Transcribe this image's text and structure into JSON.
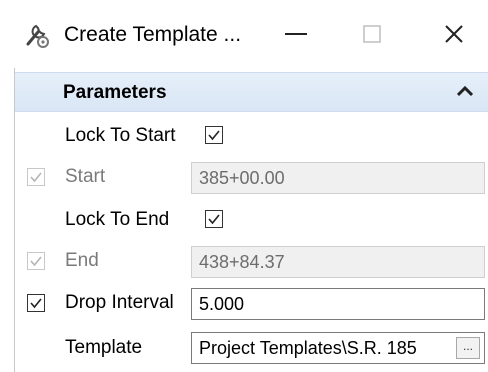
{
  "window": {
    "title": "Create Template ...",
    "min_glyph": "—",
    "max_glyph": "☐",
    "close_glyph": "✕"
  },
  "parameters": {
    "header": "Parameters",
    "lock_to_start": {
      "label": "Lock To Start",
      "checked": true
    },
    "start": {
      "label": "Start",
      "value": "385+00.00",
      "enabled": false,
      "checked": true
    },
    "lock_to_end": {
      "label": "Lock To End",
      "checked": true
    },
    "end": {
      "label": "End",
      "value": "438+84.37",
      "enabled": false,
      "checked": true
    },
    "drop_interval": {
      "label": "Drop Interval",
      "value": "5.000",
      "checked": true
    },
    "template": {
      "label": "Template",
      "value": "Project Templates\\S.R. 185",
      "browse_label": "..."
    }
  }
}
